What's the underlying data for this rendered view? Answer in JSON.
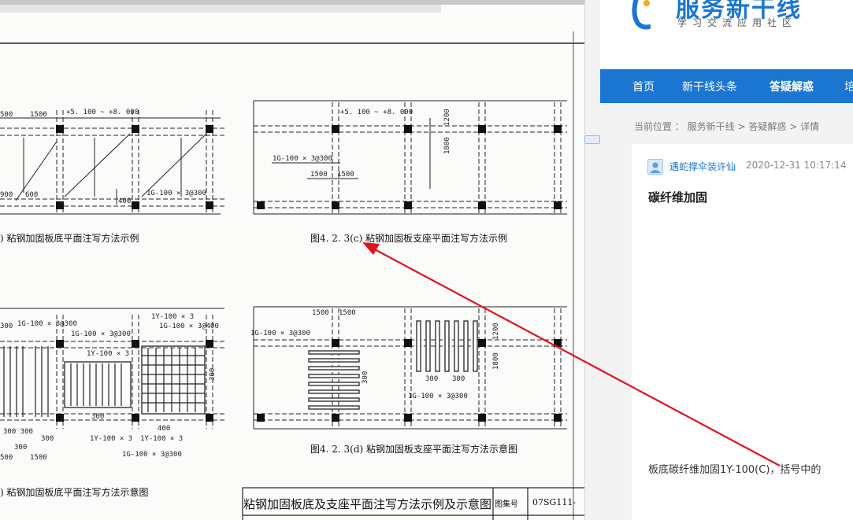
{
  "drawing": {
    "fig_c_caption": "图4. 2. 3(c) 粘钢加固板支座平面注写方法示例",
    "fig_a_caption": ") 粘钢加固板底平面注写方法示例",
    "fig_d_caption": "图4. 2. 3(d) 粘钢加固板支座平面注写方法示意图",
    "fig_b_caption": ") 粘钢加固板底平面注写方法示意图",
    "title_block": "粘钢加固板底及支座平面注写方法示例及示意图",
    "atlas_label": "图集号",
    "atlas_no": "07SG111-",
    "dims": {
      "d1500a": "500",
      "d1500b": "1500",
      "elev_a": "+5. 100 ~ +8. 000",
      "elev_c": "+5. 100 ~ +8. 000",
      "d900": "900",
      "d600": "600",
      "d400": "400",
      "note_1g_a": "1G-100 × 3@300",
      "note_1g_c": "1G-100 × 3@300",
      "d1500c": "1500",
      "d1500d": "1500",
      "d1800": "1800",
      "d1200": "1200",
      "note_1g_b1": "1G-100 × 3@300",
      "note_1g_b2": "1G-100 × 3@300",
      "note_1g_b3": "1G-100 × 3@400",
      "note_1y_b1": "1Y-100 × 3",
      "note_1y_b2": "1Y-100 × 3",
      "note_1y_b3": "1Y-100 × 3",
      "note_1y_b4": "1Y-100 × 3",
      "note_1g_b4": "1G-100 × 3@300",
      "d300a": "300 300",
      "d300b": "300",
      "d300c": "300",
      "d1500e": "500",
      "d1500f": "1500",
      "d400b": "400",
      "d300d": "300",
      "d1500g": "1500",
      "d1500h": "1500",
      "note_1g_d1": "1G-100 × 3@300",
      "d300e": "300",
      "d300f": "300",
      "note_1g_d2": "1G-100 × 3@300",
      "d1800b": "1800",
      "d1200b": "1200",
      "d300g": "300",
      "d300h": "300"
    }
  },
  "site": {
    "logo_title": "服务新干线",
    "logo_subtitle": "学习交流应用社区",
    "nav": [
      "首页",
      "新干线头条",
      "答疑解惑",
      "培"
    ],
    "breadcrumb": {
      "prefix": "当前位置 ：",
      "crumbs": [
        "服务新干线",
        "答疑解惑",
        "详情"
      ],
      "sep": " > "
    },
    "post": {
      "author": "遇蛇撑伞装许仙",
      "time": "2020-12-31 10:17:14",
      "title": "碳纤维加固",
      "body": "板底碳纤维加固1Y-100(C)，括号中的"
    }
  },
  "colors": {
    "brand_blue": "#1a76d2",
    "arrow_red": "#e0141e"
  }
}
